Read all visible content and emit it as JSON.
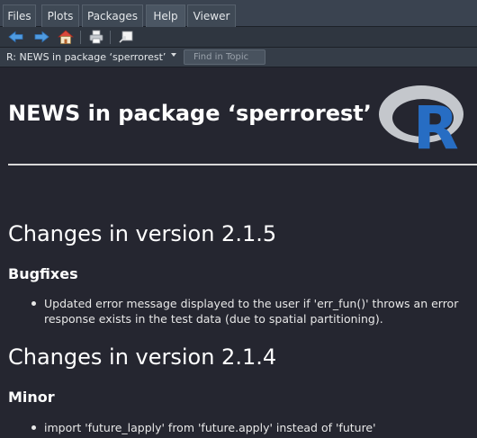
{
  "tabs": [
    {
      "label": "Files"
    },
    {
      "label": "Plots"
    },
    {
      "label": "Packages"
    },
    {
      "label": "Help"
    },
    {
      "label": "Viewer"
    }
  ],
  "active_tab": "Help",
  "toolbar": {
    "icons": [
      "back-arrow-icon",
      "forward-arrow-icon",
      "home-icon",
      "print-icon",
      "open-in-new-window-icon"
    ]
  },
  "topic_bar": {
    "topic": "R: NEWS in package ‘sperrorest’",
    "find_placeholder": "Find in Topic",
    "find_value": ""
  },
  "doc": {
    "title": "NEWS in package ‘sperrorest’",
    "logo_letter": "R",
    "sections": [
      {
        "heading": "Changes in version 2.1.5",
        "subheading": "Bugfixes",
        "items": [
          {
            "line1": "Updated error message displayed to the user if 'err_fun()' throws an error",
            "line2": "response exists in the test data (due to spatial partitioning)."
          }
        ]
      },
      {
        "heading": "Changes in version 2.1.4",
        "subheading": "Minor",
        "items": [
          {
            "line1": "import 'future_lapply' from 'future.apply' instead of 'future'"
          }
        ]
      }
    ]
  },
  "colors": {
    "background": "#252630",
    "tab_bar": "#3a4350",
    "toolbar": "#2f3640",
    "text": "#f3f3f3",
    "r_logo_blue": "#276dc3",
    "r_logo_ring": "#c4c7cc"
  }
}
